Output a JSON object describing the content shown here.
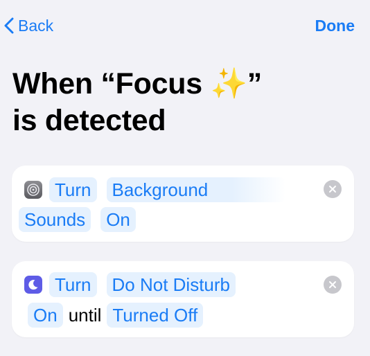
{
  "nav": {
    "back_label": "Back",
    "done_label": "Done"
  },
  "title": {
    "line1": "When “Focus ✨”",
    "line2": "is detected"
  },
  "actions": [
    {
      "app_icon": "settings-gear-icon",
      "tokens": [
        "Turn",
        "Background",
        "Sounds",
        "On"
      ]
    },
    {
      "app_icon": "moon-icon",
      "tokens": [
        "Turn",
        "Do Not Disturb",
        "On",
        "Turned Off"
      ],
      "connector": "until"
    }
  ],
  "colors": {
    "accent": "#1a7cf5",
    "token_bg": "#e5f1fe",
    "background": "#f2f2f7",
    "dnd_purple": "#5e5ce6"
  }
}
